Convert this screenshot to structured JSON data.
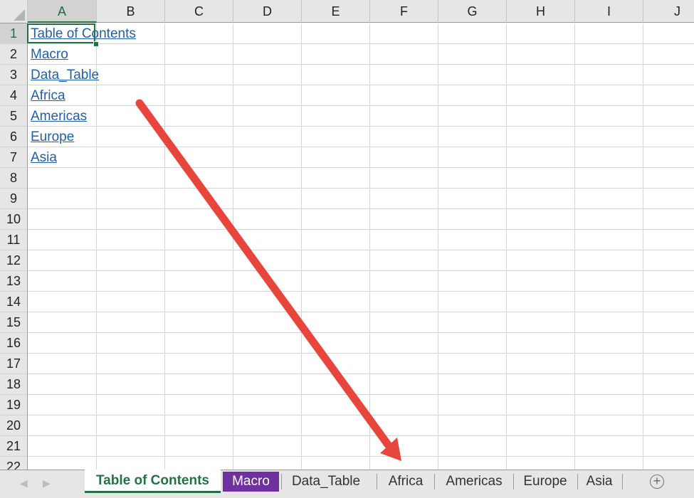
{
  "spreadsheet": {
    "columns": [
      "A",
      "B",
      "C",
      "D",
      "E",
      "F",
      "G",
      "H",
      "I",
      "J"
    ],
    "selected_column": "A",
    "rows": [
      "1",
      "2",
      "3",
      "4",
      "5",
      "6",
      "7",
      "8",
      "9",
      "10",
      "11",
      "12",
      "13",
      "14",
      "15",
      "16",
      "17",
      "18",
      "19",
      "20",
      "21",
      "22"
    ],
    "selected_row": "1",
    "selected_cell": "A1",
    "cells": {
      "A1": "Table of Contents",
      "A2": "Macro",
      "A3": "Data_Table ",
      "A4": "Africa",
      "A5": "Americas",
      "A6": "Europe",
      "A7": "Asia"
    }
  },
  "sheet_tabs": {
    "prev_icon": "◀",
    "next_icon": "▶",
    "tabs": [
      {
        "label": "Table of Contents",
        "active": true,
        "color": "#217346"
      },
      {
        "label": "Macro",
        "active": false,
        "color": "#7030a0"
      },
      {
        "label": "Data_Table",
        "active": false
      },
      {
        "label": "Africa",
        "active": false
      },
      {
        "label": "Americas",
        "active": false
      },
      {
        "label": "Europe",
        "active": false
      },
      {
        "label": "Asia",
        "active": false
      }
    ],
    "add_sheet_icon": "+"
  },
  "annotation": {
    "type": "arrow",
    "color": "#e8453c",
    "points_to": "sheet_tabs"
  }
}
